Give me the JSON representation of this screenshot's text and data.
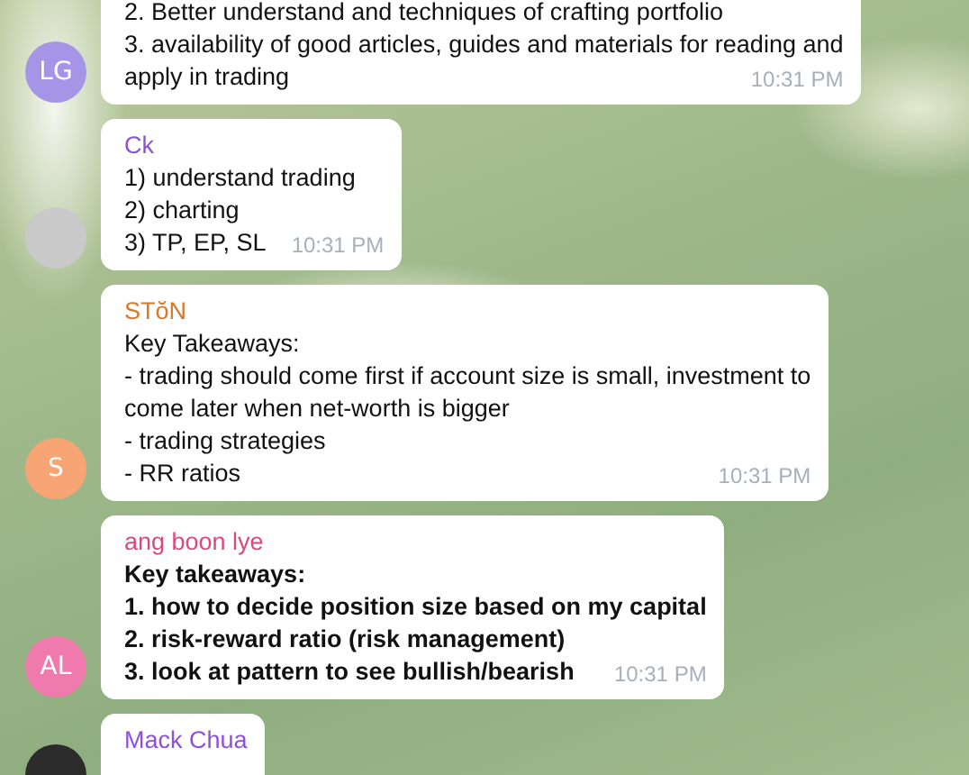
{
  "messages": [
    {
      "avatar": {
        "kind": "initials",
        "initials": "LG",
        "color": "#a695e7"
      },
      "bold": false,
      "lines": [
        "2. Better understand and techniques of crafting portfolio",
        "3. availability of good articles, guides and materials for reading and",
        "apply in trading"
      ],
      "time": "10:31 PM"
    },
    {
      "sender": {
        "name": "Ck",
        "color": "#8e4fdc"
      },
      "avatar": {
        "kind": "photo",
        "color": "#c9c9c9"
      },
      "bold": false,
      "lines": [
        "1) understand trading",
        "2) charting",
        "3) TP, EP, SL"
      ],
      "time": "10:31 PM"
    },
    {
      "sender": {
        "name": "STŏN",
        "color": "#d9782a"
      },
      "avatar": {
        "kind": "initials",
        "initials": "S",
        "color": "#f7a574"
      },
      "bold": false,
      "lines": [
        "Key Takeaways:",
        "- trading should come first if account size is small, investment to",
        "come later when net-worth is bigger",
        "- trading strategies",
        "- RR ratios"
      ],
      "time": "10:31 PM"
    },
    {
      "sender": {
        "name": "ang boon lye",
        "color": "#d94a7d"
      },
      "avatar": {
        "kind": "initials",
        "initials": "AL",
        "color": "#ee7aae"
      },
      "bold": true,
      "lines": [
        "Key takeaways:",
        "1. how to decide position size based on my capital",
        "2. risk-reward ratio (risk management)",
        "3. look at pattern to see bullish/bearish"
      ],
      "time": "10:31 PM"
    },
    {
      "sender": {
        "name": "Mack Chua",
        "color": "#8e4fdc"
      },
      "avatar": {
        "kind": "photo",
        "color": "#2b2b2b"
      }
    }
  ]
}
